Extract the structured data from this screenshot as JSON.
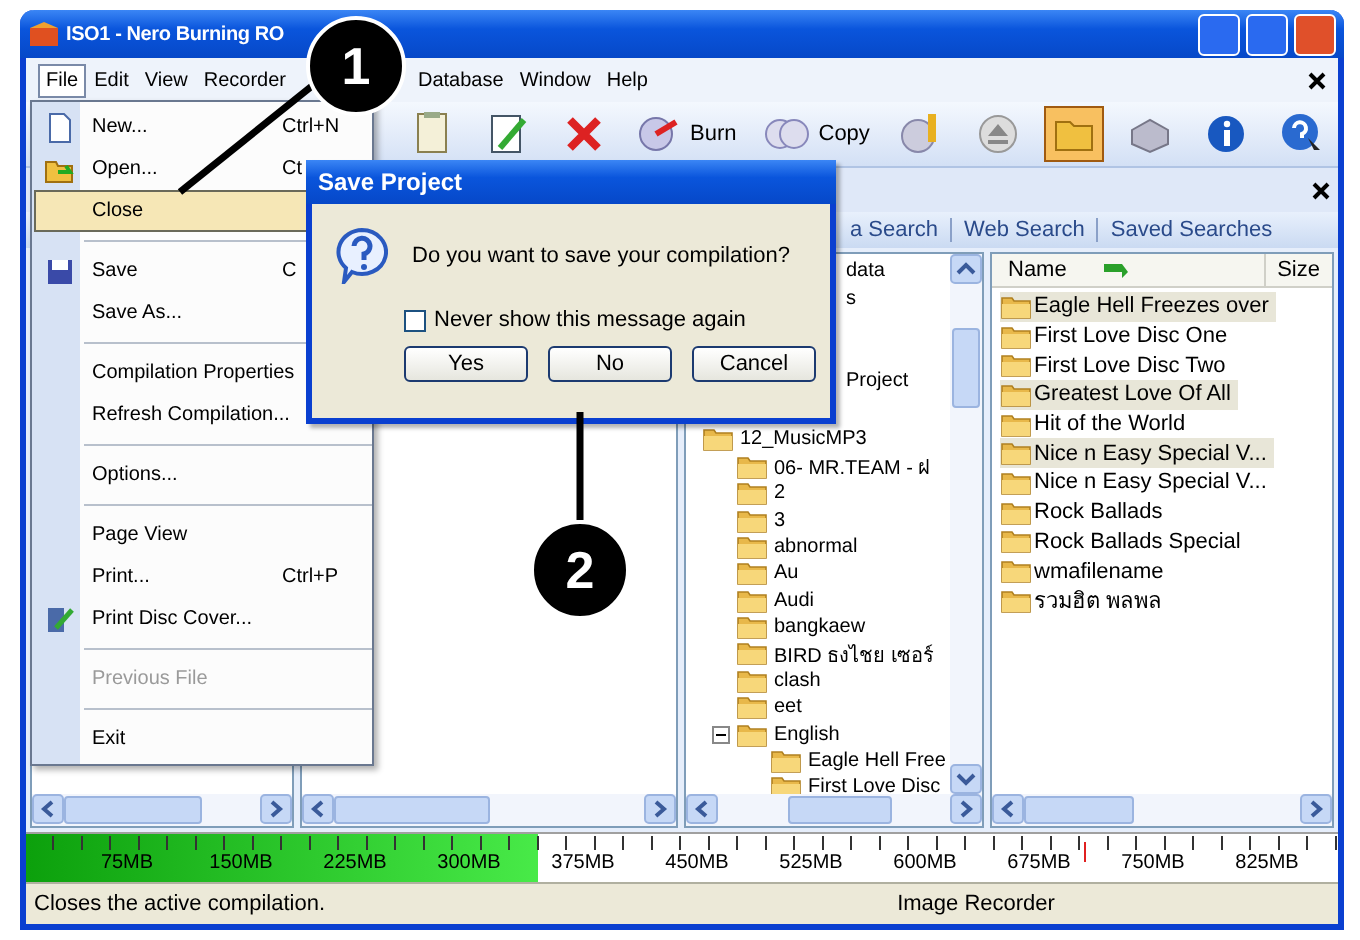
{
  "window": {
    "title": "ISO1 - Nero Burning RO"
  },
  "menubar": [
    {
      "label": "File",
      "selected": true
    },
    {
      "label": "Edit",
      "selected": false
    },
    {
      "label": "View",
      "selected": false
    },
    {
      "label": "Recorder",
      "selected": false
    },
    {
      "label": "Database",
      "selected": false
    },
    {
      "label": "Window",
      "selected": false
    },
    {
      "label": "Help",
      "selected": false
    }
  ],
  "toolbar": [
    {
      "kind": "icon",
      "selected": false
    },
    {
      "kind": "icon",
      "selected": false
    },
    {
      "kind": "icon",
      "selected": false
    },
    {
      "kind": "labeled",
      "label": "Burn",
      "selected": false
    },
    {
      "kind": "labeled",
      "label": "Copy",
      "selected": false
    },
    {
      "kind": "icon",
      "selected": false
    },
    {
      "kind": "icon",
      "selected": false
    },
    {
      "kind": "icon",
      "selected": true
    },
    {
      "kind": "icon",
      "selected": false
    },
    {
      "kind": "icon",
      "selected": false
    },
    {
      "kind": "icon",
      "selected": false
    }
  ],
  "file_menu": [
    {
      "kind": "item",
      "label": "New...",
      "shortcut": "Ctrl+N",
      "selected": false,
      "disabled": false
    },
    {
      "kind": "item",
      "label": "Open...",
      "shortcut": "Ct",
      "selected": false,
      "disabled": false
    },
    {
      "kind": "item",
      "label": "Close",
      "selected": true,
      "disabled": false
    },
    {
      "kind": "separator"
    },
    {
      "kind": "item",
      "label": "Save",
      "shortcut": "C",
      "selected": false,
      "disabled": false
    },
    {
      "kind": "item",
      "label": "Save As...",
      "selected": false,
      "disabled": false
    },
    {
      "kind": "separator"
    },
    {
      "kind": "item",
      "label": "Compilation Properties",
      "selected": false,
      "disabled": false
    },
    {
      "kind": "item",
      "label": "Refresh Compilation...",
      "selected": false,
      "disabled": false
    },
    {
      "kind": "separator"
    },
    {
      "kind": "item",
      "label": "Options...",
      "selected": false,
      "disabled": false
    },
    {
      "kind": "separator"
    },
    {
      "kind": "item",
      "label": "Page View",
      "selected": false,
      "disabled": false
    },
    {
      "kind": "item",
      "label": "Print...",
      "shortcut": "Ctrl+P",
      "selected": false,
      "disabled": false
    },
    {
      "kind": "item",
      "label": "Print Disc Cover...",
      "selected": false,
      "disabled": false
    },
    {
      "kind": "separator"
    },
    {
      "kind": "item",
      "label": "Previous File",
      "selected": false,
      "disabled": true
    },
    {
      "kind": "separator"
    },
    {
      "kind": "item",
      "label": "Exit",
      "selected": false,
      "disabled": false
    }
  ],
  "search_tabs": [
    {
      "label": "a Search"
    },
    {
      "label": "Web Search"
    },
    {
      "label": "Saved Searches"
    }
  ],
  "dialog": {
    "title": "Save Project",
    "message": "Do you want to save your compilation?",
    "checkbox": {
      "label": "Never show this message again",
      "checked": false
    },
    "buttons": [
      "Yes",
      "No",
      "Cancel"
    ]
  },
  "browser_tree": [
    {
      "kind": "clipped",
      "label": "data"
    },
    {
      "kind": "clipped",
      "label": "s"
    },
    {
      "kind": "clipped",
      "label": "Project"
    },
    {
      "kind": "folder",
      "label": "12_MusicMP3",
      "children": [
        {
          "kind": "folder",
          "label": "06- MR.TEAM - ฝ"
        },
        {
          "kind": "folder",
          "label": "2"
        },
        {
          "kind": "folder",
          "label": "3"
        },
        {
          "kind": "folder",
          "label": "abnormal"
        },
        {
          "kind": "folder",
          "label": "Au"
        },
        {
          "kind": "folder",
          "label": "Audi"
        },
        {
          "kind": "folder",
          "label": "bangkaew"
        },
        {
          "kind": "folder",
          "label": "BIRD ธงไชย เซอร์"
        },
        {
          "kind": "folder",
          "label": "clash"
        },
        {
          "kind": "folder",
          "label": "eet"
        },
        {
          "kind": "folder",
          "label": "English",
          "expanded": true,
          "children": [
            {
              "kind": "folder",
              "label": "Eagle Hell Free"
            },
            {
              "kind": "folder",
              "label": "First Love Disc"
            }
          ]
        }
      ]
    }
  ],
  "file_list": {
    "columns": [
      "Name",
      "Size"
    ],
    "rows": [
      {
        "name": "Eagle Hell Freezes over",
        "selected": true
      },
      {
        "name": "First Love Disc One",
        "selected": false
      },
      {
        "name": "First Love Disc Two",
        "selected": false
      },
      {
        "name": "Greatest Love Of All",
        "selected": true
      },
      {
        "name": "Hit of the World",
        "selected": false
      },
      {
        "name": "Nice n Easy Special V...",
        "selected": true
      },
      {
        "name": "Nice n Easy Special V...",
        "selected": false
      },
      {
        "name": "Rock Ballads",
        "selected": false
      },
      {
        "name": "Rock Ballads Special",
        "selected": false
      },
      {
        "name": "wmafilename",
        "selected": false
      },
      {
        "name": "รวมฮิต พลพล",
        "selected": false
      }
    ]
  },
  "capacity_bar": {
    "level": 0.39,
    "labels": [
      "75MB",
      "150MB",
      "225MB",
      "300MB",
      "375MB",
      "450MB",
      "525MB",
      "600MB",
      "675MB",
      "750MB",
      "825MB"
    ]
  },
  "status_bar": {
    "message": "Closes the active compilation.",
    "recorder": "Image Recorder"
  },
  "callouts": [
    "1",
    "2"
  ]
}
